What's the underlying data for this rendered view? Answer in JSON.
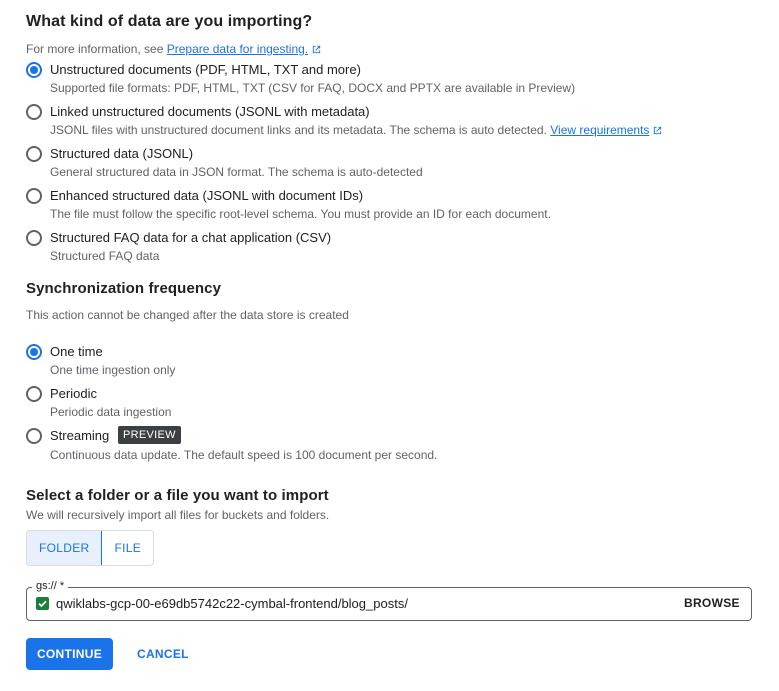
{
  "data_kind": {
    "title": "What kind of data are you importing?",
    "info_prefix": "For more information, see",
    "info_link": "Prepare data for ingesting.",
    "options": [
      {
        "label": "Unstructured documents (PDF, HTML, TXT and more)",
        "desc": "Supported file formats: PDF, HTML, TXT (CSV for FAQ, DOCX and PPTX are available in Preview)",
        "checked": true
      },
      {
        "label": "Linked unstructured documents (JSONL with metadata)",
        "desc": "JSONL files with unstructured document links and its metadata. The schema is auto detected.",
        "link": "View requirements",
        "checked": false
      },
      {
        "label": "Structured data (JSONL)",
        "desc": "General structured data in JSON format. The schema is auto-detected",
        "checked": false
      },
      {
        "label": "Enhanced structured data (JSONL with document IDs)",
        "desc": "The file must follow the specific root-level schema. You must provide an ID for each document.",
        "checked": false
      },
      {
        "label": "Structured FAQ data for a chat application (CSV)",
        "desc": "Structured FAQ data",
        "checked": false
      }
    ]
  },
  "sync": {
    "title": "Synchronization frequency",
    "note": "This action cannot be changed after the data store is created",
    "options": [
      {
        "label": "One time",
        "desc": "One time ingestion only",
        "checked": true
      },
      {
        "label": "Periodic",
        "desc": "Periodic data ingestion",
        "checked": false
      },
      {
        "label": "Streaming",
        "badge": "PREVIEW",
        "desc": "Continuous data update. The default speed is 100 document per second.",
        "checked": false
      }
    ]
  },
  "import": {
    "title": "Select a folder or a file you want to import",
    "note": "We will recursively import all files for buckets and folders.",
    "folder_label": "FOLDER",
    "file_label": "FILE",
    "field_label": "gs:// *",
    "path": "qwiklabs-gcp-00-e69db5742c22-cymbal-frontend/blog_posts/",
    "browse_label": "BROWSE"
  },
  "actions": {
    "continue_label": "CONTINUE",
    "cancel_label": "CANCEL"
  },
  "colors": {
    "accent": "#1a73e8",
    "valid_check": "#188038",
    "badge_bg": "#3c4043"
  }
}
